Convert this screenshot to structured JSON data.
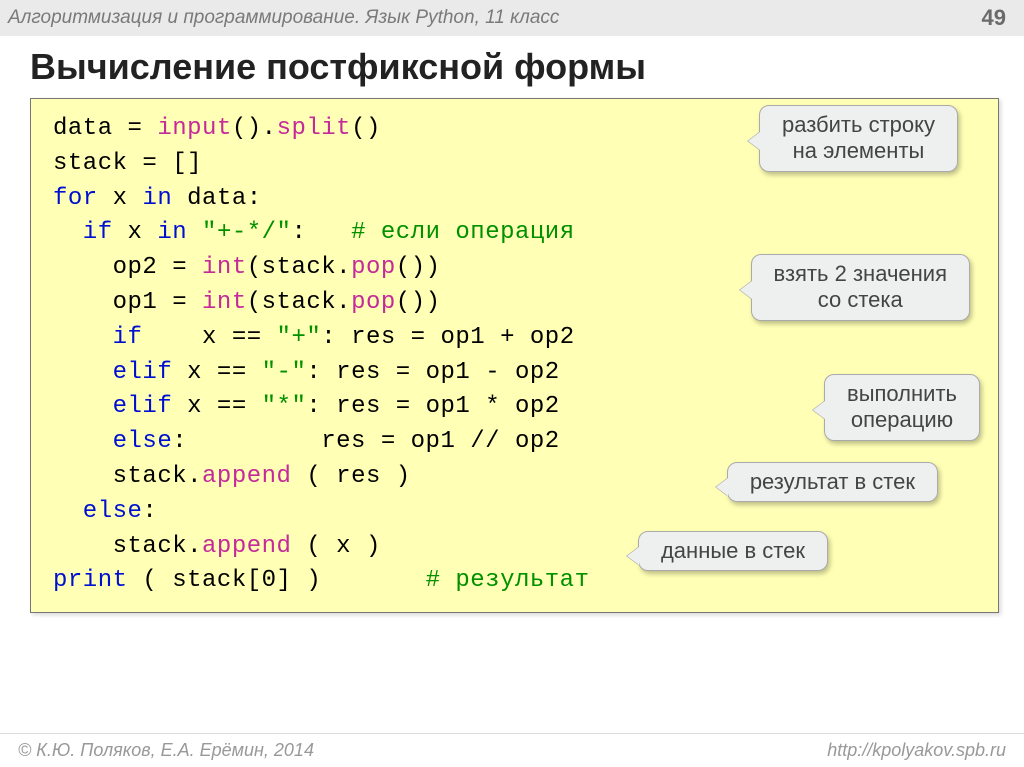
{
  "header": {
    "breadcrumb": "Алгоритмизация и программирование. Язык Python, 11 класс",
    "page_number": "49"
  },
  "title": "Вычисление постфиксной формы",
  "code": {
    "l1_a": "data = ",
    "l1_b": "input",
    "l1_c": "().",
    "l1_d": "split",
    "l1_e": "()",
    "l2": "stack = []",
    "l3_a": "for",
    "l3_b": " x ",
    "l3_c": "in",
    "l3_d": " data:",
    "l4_a": "  if",
    "l4_b": " x ",
    "l4_c": "in",
    "l4_d": " ",
    "l4_e": "\"+-*/\"",
    "l4_f": ":   ",
    "l4_g": "# если операция",
    "l5_a": "    op2 = ",
    "l5_b": "int",
    "l5_c": "(stack.",
    "l5_d": "pop",
    "l5_e": "())",
    "l6_a": "    op1 = ",
    "l6_b": "int",
    "l6_c": "(stack.",
    "l6_d": "pop",
    "l6_e": "())",
    "l7_a": "    if",
    "l7_b": "    x == ",
    "l7_c": "\"+\"",
    "l7_d": ": res = op1 + op2",
    "l8_a": "    elif",
    "l8_b": " x == ",
    "l8_c": "\"-\"",
    "l8_d": ": res = op1 - op2",
    "l9_a": "    elif",
    "l9_b": " x == ",
    "l9_c": "\"*\"",
    "l9_d": ": res = op1 * op2",
    "l10_a": "    else",
    "l10_b": ":         res = op1 // op2",
    "l11_a": "    stack.",
    "l11_b": "append",
    "l11_c": " ( res )",
    "l12_a": "  else",
    "l12_b": ":",
    "l13_a": "    stack.",
    "l13_b": "append",
    "l13_c": " ( x )",
    "l14_a": "print",
    "l14_b": " ( stack[0] )       ",
    "l14_c": "# результат"
  },
  "callouts": {
    "c1_l1": "разбить строку",
    "c1_l2": "на элементы",
    "c2_l1": "взять 2 значения",
    "c2_l2": "со стека",
    "c3_l1": "выполнить",
    "c3_l2": "операцию",
    "c4": "результат в стек",
    "c5": "данные в стек"
  },
  "footer": {
    "left": "© К.Ю. Поляков, Е.А. Ерёмин, 2014",
    "right": "http://kpolyakov.spb.ru"
  }
}
